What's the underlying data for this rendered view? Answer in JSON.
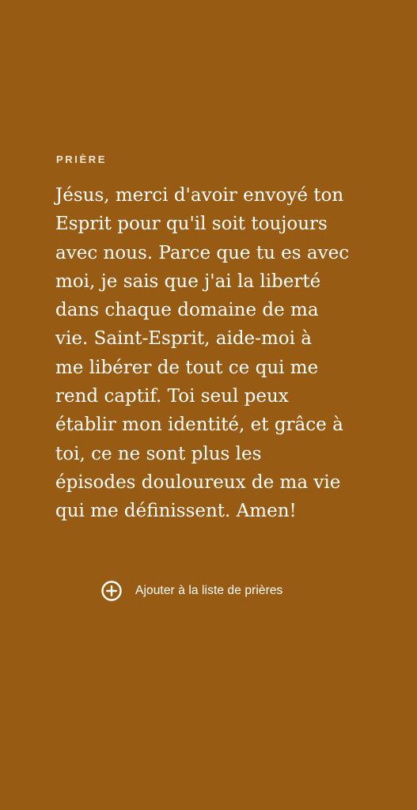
{
  "colors": {
    "background": "#985b13",
    "text": "#ffffff",
    "label": "#f3e6d6"
  },
  "prayer": {
    "section_label": "PRIÈRE",
    "text": "Jésus, merci d'avoir envoyé ton\nEsprit pour qu'il soit toujours\navec nous. Parce que tu es avec\nmoi, je sais que j'ai la liberté\ndans chaque domaine de ma\nvie. Saint-Esprit, aide-moi à\nme libérer de tout ce qui me\nrend captif. Toi seul peux\nétablir mon identité, et grâce à\ntoi, ce ne sont plus les\népisodes douloureux de ma vie\nqui me définissent. Amen!"
  },
  "actions": {
    "add_to_list_label": "Ajouter à la liste de prières",
    "add_icon": "plus-circle-icon"
  }
}
